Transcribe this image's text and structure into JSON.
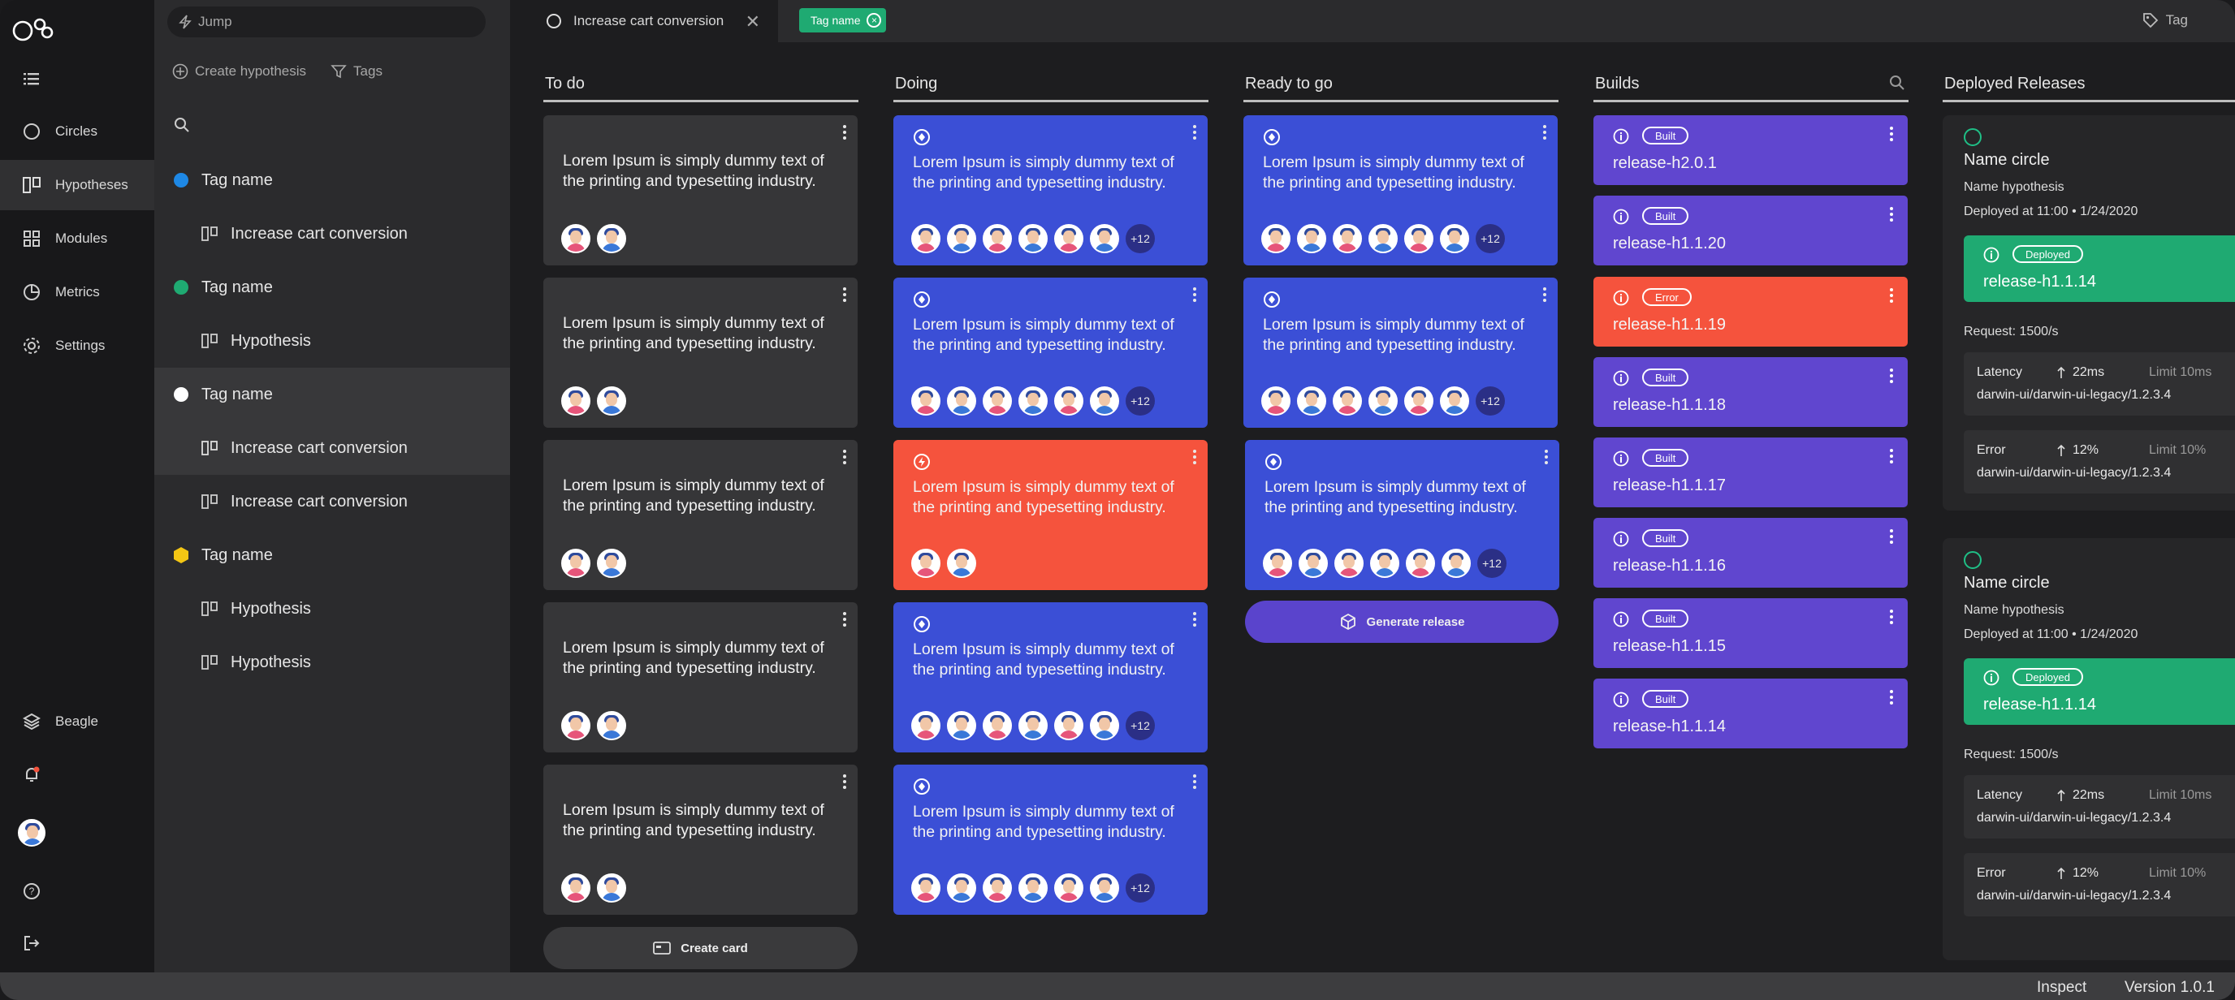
{
  "nav": {
    "items": [
      {
        "label": "Circles",
        "icon": "circle-icon"
      },
      {
        "label": "Hypotheses",
        "icon": "hypotheses-icon"
      },
      {
        "label": "Modules",
        "icon": "modules-icon"
      },
      {
        "label": "Metrics",
        "icon": "metrics-icon"
      },
      {
        "label": "Settings",
        "icon": "settings-icon"
      }
    ],
    "workspace": "Beagle"
  },
  "panel": {
    "jump_placeholder": "Jump",
    "create_label": "Create hypothesis",
    "tags_label": "Tags",
    "groups": [
      {
        "tag": "Tag name",
        "color": "#1e88e5",
        "items": [
          "Increase cart conversion"
        ]
      },
      {
        "tag": "Tag name",
        "color": "#1faa72",
        "items": [
          "Hypothesis"
        ]
      },
      {
        "tag": "Tag name",
        "color": "#ffffff",
        "items": [
          "Increase cart conversion",
          "Increase cart conversion"
        ]
      },
      {
        "tag": "Tag name",
        "color": "#f3c614",
        "items": [
          "Hypothesis",
          "Hypothesis"
        ]
      }
    ]
  },
  "tabbar": {
    "tab_title": "Increase cart conversion",
    "close": "✕",
    "chip": "Tag name",
    "tag_button": "Tag"
  },
  "columns": {
    "todo": "To do",
    "doing": "Doing",
    "ready": "Ready to go",
    "builds": "Builds",
    "releases": "Deployed Releases"
  },
  "card_text": "Lorem Ipsum is simply dummy text of the printing and typesetting industry.",
  "more_count": "+12",
  "create_card": "Create card",
  "generate_release": "Generate release",
  "builds": [
    {
      "status": "Built",
      "name": "release-h2.0.1"
    },
    {
      "status": "Built",
      "name": "release-h1.1.20"
    },
    {
      "status": "Error",
      "name": "release-h1.1.19"
    },
    {
      "status": "Built",
      "name": "release-h1.1.18"
    },
    {
      "status": "Built",
      "name": "release-h1.1.17"
    },
    {
      "status": "Built",
      "name": "release-h1.1.16"
    },
    {
      "status": "Built",
      "name": "release-h1.1.15"
    },
    {
      "status": "Built",
      "name": "release-h1.1.14"
    }
  ],
  "releases": [
    {
      "circle": "Name circle",
      "hypothesis": "Name hypothesis",
      "deployed_at": "Deployed at 11:00 • 1/24/2020",
      "status": "Deployed",
      "release": "release-h1.1.14",
      "request": "Request: 1500/s",
      "latency": {
        "label": "Latency",
        "value": "22ms",
        "limit": "Limit 10ms",
        "path": "darwin-ui/darwin-ui-legacy/1.2.3.4"
      },
      "error": {
        "label": "Error",
        "value": "12%",
        "limit": "Limit 10%",
        "path": "darwin-ui/darwin-ui-legacy/1.2.3.4"
      }
    },
    {
      "circle": "Name circle",
      "hypothesis": "Name hypothesis",
      "deployed_at": "Deployed at 11:00 • 1/24/2020",
      "status": "Deployed",
      "release": "release-h1.1.14",
      "request": "Request: 1500/s",
      "latency": {
        "label": "Latency",
        "value": "22ms",
        "limit": "Limit 10ms",
        "path": "darwin-ui/darwin-ui-legacy/1.2.3.4"
      },
      "error": {
        "label": "Error",
        "value": "12%",
        "limit": "Limit 10%",
        "path": "darwin-ui/darwin-ui-legacy/1.2.3.4"
      }
    }
  ],
  "footer": {
    "inspect": "Inspect",
    "version": "Version 1.0.1"
  },
  "colors": {
    "blue_card": "#3b4fd6",
    "red_card": "#f5533d",
    "gray_card": "#363638",
    "build_purple": "#6046cf",
    "build_error": "#f5533d",
    "deployed_green": "#1faa72"
  }
}
